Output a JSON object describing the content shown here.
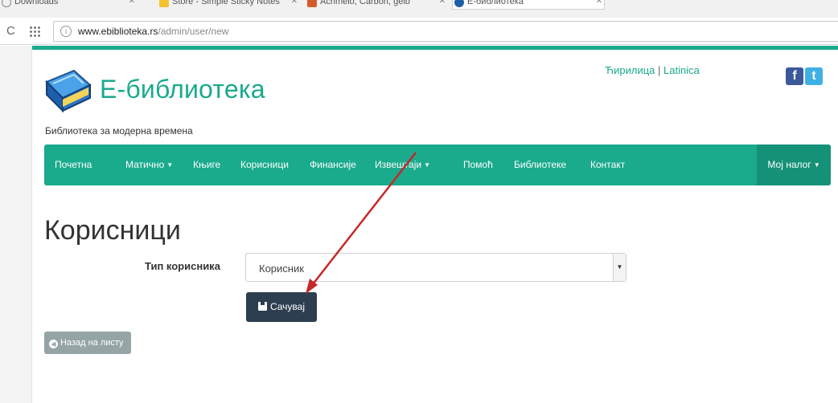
{
  "browser": {
    "tabs": [
      {
        "label": "Downloads"
      },
      {
        "label": "Store - Simple Sticky Notes"
      },
      {
        "label": "Achmelo, Carbon, gelb"
      },
      {
        "label": "Е-библиотека"
      }
    ],
    "url": {
      "host": "www.ebiblioteka.rs",
      "path": "/admin/user/new"
    }
  },
  "header": {
    "site_title": "Е-библиотека",
    "tagline": "Библиотека за модерна времена",
    "lang_cyrillic": "Ћирилица",
    "lang_separator": "|",
    "lang_latin": "Latinica",
    "facebook": "f",
    "twitter": "t"
  },
  "nav": {
    "items": [
      {
        "label": "Почетна"
      },
      {
        "label": "Матично"
      },
      {
        "label": "Књиге"
      },
      {
        "label": "Корисници"
      },
      {
        "label": "Финансије"
      },
      {
        "label": "Извештаји"
      },
      {
        "label": "Помоћ"
      },
      {
        "label": "Библиотеке"
      },
      {
        "label": "Контакт"
      }
    ],
    "account": "Мој налог"
  },
  "main": {
    "title": "Корисници",
    "user_type_label": "Тип корисника",
    "user_type_value": "Корисник",
    "save_label": "Сачувај",
    "back_label": "Назад на листу"
  },
  "colors": {
    "brand": "#1aaa8c",
    "brand_dark": "#159177",
    "save": "#2c3e50",
    "back": "#95a5a6",
    "arrow": "#c62828"
  }
}
